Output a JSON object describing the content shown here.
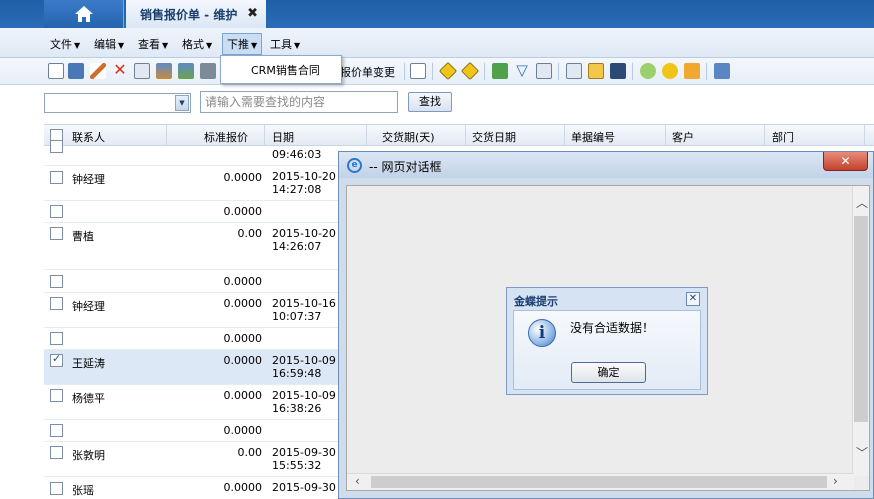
{
  "tabs": {
    "document_tab": "销售报价单 - 维护",
    "close_glyph": "✖"
  },
  "menu": [
    {
      "label": "文件"
    },
    {
      "label": "编辑"
    },
    {
      "label": "查看"
    },
    {
      "label": "格式"
    },
    {
      "label": "下推"
    },
    {
      "label": "工具"
    }
  ],
  "menu_arrow": "▼",
  "dropdown": {
    "item": "CRM销售合同"
  },
  "toolbar": {
    "text_button": "报价单变更"
  },
  "search": {
    "placeholder": "请输入需要查找的内容",
    "button": "查找"
  },
  "grid": {
    "headers": [
      "联系人",
      "标准报价",
      "日期",
      "交货期(天)",
      "交货日期",
      "单据编号",
      "客户",
      "部门"
    ],
    "rows": [
      {
        "contact": "",
        "price": "",
        "date": "",
        "time": "09:46:03",
        "checked": false
      },
      {
        "contact": "钟经理",
        "price": "0.0000",
        "date": "2015-10-20",
        "time": "14:27:08",
        "checked": false
      },
      {
        "contact": "",
        "price": "0.0000",
        "date": "",
        "time": "",
        "checked": false
      },
      {
        "contact": "曹植",
        "price": "0.00",
        "date": "2015-10-20",
        "time": "14:26:07",
        "checked": false
      },
      {
        "contact": "",
        "price": "0.0000",
        "date": "",
        "time": "",
        "checked": false
      },
      {
        "contact": "钟经理",
        "price": "0.0000",
        "date": "2015-10-16",
        "time": "10:07:37",
        "checked": false
      },
      {
        "contact": "",
        "price": "0.0000",
        "date": "",
        "time": "",
        "checked": false
      },
      {
        "contact": "王延涛",
        "price": "0.0000",
        "date": "2015-10-09",
        "time": "16:59:48",
        "checked": true
      },
      {
        "contact": "杨德平",
        "price": "0.0000",
        "date": "2015-10-09",
        "time": "16:38:26",
        "checked": false
      },
      {
        "contact": "",
        "price": "0.0000",
        "date": "",
        "time": "",
        "checked": false
      },
      {
        "contact": "张敦明",
        "price": "0.00",
        "date": "2015-09-30",
        "time": "15:55:32",
        "checked": false
      },
      {
        "contact": "张瑶",
        "price": "0.0000",
        "date": "2015-09-30",
        "time": "",
        "checked": false
      }
    ]
  },
  "dialog": {
    "title": "-- 网页对话框",
    "close": "✕"
  },
  "message": {
    "title": "金蝶提示",
    "close": "✕",
    "text": "没有合适数据！",
    "ok": "确定",
    "icon": "info-icon"
  },
  "colors": {
    "topbar": "#1e5fa8",
    "selected_row": "#dde8f6",
    "dialog_close": "#c2412d"
  }
}
